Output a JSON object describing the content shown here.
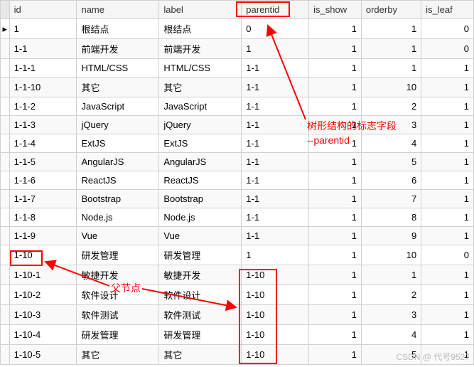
{
  "columns": [
    "id",
    "name",
    "label",
    "parentid",
    "is_show",
    "orderby",
    "is_leaf"
  ],
  "rows": [
    {
      "indicator": "▸",
      "id": "1",
      "name": "根结点",
      "label": "根结点",
      "parentid": "0",
      "is_show": "1",
      "orderby": "1",
      "is_leaf": "0"
    },
    {
      "indicator": "",
      "id": "1-1",
      "name": "前端开发",
      "label": "前端开发",
      "parentid": "1",
      "is_show": "1",
      "orderby": "1",
      "is_leaf": "0"
    },
    {
      "indicator": "",
      "id": "1-1-1",
      "name": "HTML/CSS",
      "label": "HTML/CSS",
      "parentid": "1-1",
      "is_show": "1",
      "orderby": "1",
      "is_leaf": "1"
    },
    {
      "indicator": "",
      "id": "1-1-10",
      "name": "其它",
      "label": "其它",
      "parentid": "1-1",
      "is_show": "1",
      "orderby": "10",
      "is_leaf": "1"
    },
    {
      "indicator": "",
      "id": "1-1-2",
      "name": "JavaScript",
      "label": "JavaScript",
      "parentid": "1-1",
      "is_show": "1",
      "orderby": "2",
      "is_leaf": "1"
    },
    {
      "indicator": "",
      "id": "1-1-3",
      "name": "jQuery",
      "label": "jQuery",
      "parentid": "1-1",
      "is_show": "1",
      "orderby": "3",
      "is_leaf": "1"
    },
    {
      "indicator": "",
      "id": "1-1-4",
      "name": "ExtJS",
      "label": "ExtJS",
      "parentid": "1-1",
      "is_show": "1",
      "orderby": "4",
      "is_leaf": "1"
    },
    {
      "indicator": "",
      "id": "1-1-5",
      "name": "AngularJS",
      "label": "AngularJS",
      "parentid": "1-1",
      "is_show": "1",
      "orderby": "5",
      "is_leaf": "1"
    },
    {
      "indicator": "",
      "id": "1-1-6",
      "name": "ReactJS",
      "label": "ReactJS",
      "parentid": "1-1",
      "is_show": "1",
      "orderby": "6",
      "is_leaf": "1"
    },
    {
      "indicator": "",
      "id": "1-1-7",
      "name": "Bootstrap",
      "label": "Bootstrap",
      "parentid": "1-1",
      "is_show": "1",
      "orderby": "7",
      "is_leaf": "1"
    },
    {
      "indicator": "",
      "id": "1-1-8",
      "name": "Node.js",
      "label": "Node.js",
      "parentid": "1-1",
      "is_show": "1",
      "orderby": "8",
      "is_leaf": "1"
    },
    {
      "indicator": "",
      "id": "1-1-9",
      "name": "Vue",
      "label": "Vue",
      "parentid": "1-1",
      "is_show": "1",
      "orderby": "9",
      "is_leaf": "1"
    },
    {
      "indicator": "",
      "id": "1-10",
      "name": "研发管理",
      "label": "研发管理",
      "parentid": "1",
      "is_show": "1",
      "orderby": "10",
      "is_leaf": "0"
    },
    {
      "indicator": "",
      "id": "1-10-1",
      "name": "敏捷开发",
      "label": "敏捷开发",
      "parentid": "1-10",
      "is_show": "1",
      "orderby": "1",
      "is_leaf": "1"
    },
    {
      "indicator": "",
      "id": "1-10-2",
      "name": "软件设计",
      "label": "软件设计",
      "parentid": "1-10",
      "is_show": "1",
      "orderby": "2",
      "is_leaf": "1"
    },
    {
      "indicator": "",
      "id": "1-10-3",
      "name": "软件测试",
      "label": "软件测试",
      "parentid": "1-10",
      "is_show": "1",
      "orderby": "3",
      "is_leaf": "1"
    },
    {
      "indicator": "",
      "id": "1-10-4",
      "name": "研发管理",
      "label": "研发管理",
      "parentid": "1-10",
      "is_show": "1",
      "orderby": "4",
      "is_leaf": "1"
    },
    {
      "indicator": "",
      "id": "1-10-5",
      "name": "其它",
      "label": "其它",
      "parentid": "1-10",
      "is_show": "1",
      "orderby": "5",
      "is_leaf": "1"
    }
  ],
  "annotations": {
    "tree_field_note_1": "树形结构的标志字段",
    "tree_field_note_2": "--parentid",
    "parent_node_note": "父节点"
  },
  "watermark": "CSDN @ 代号9527"
}
